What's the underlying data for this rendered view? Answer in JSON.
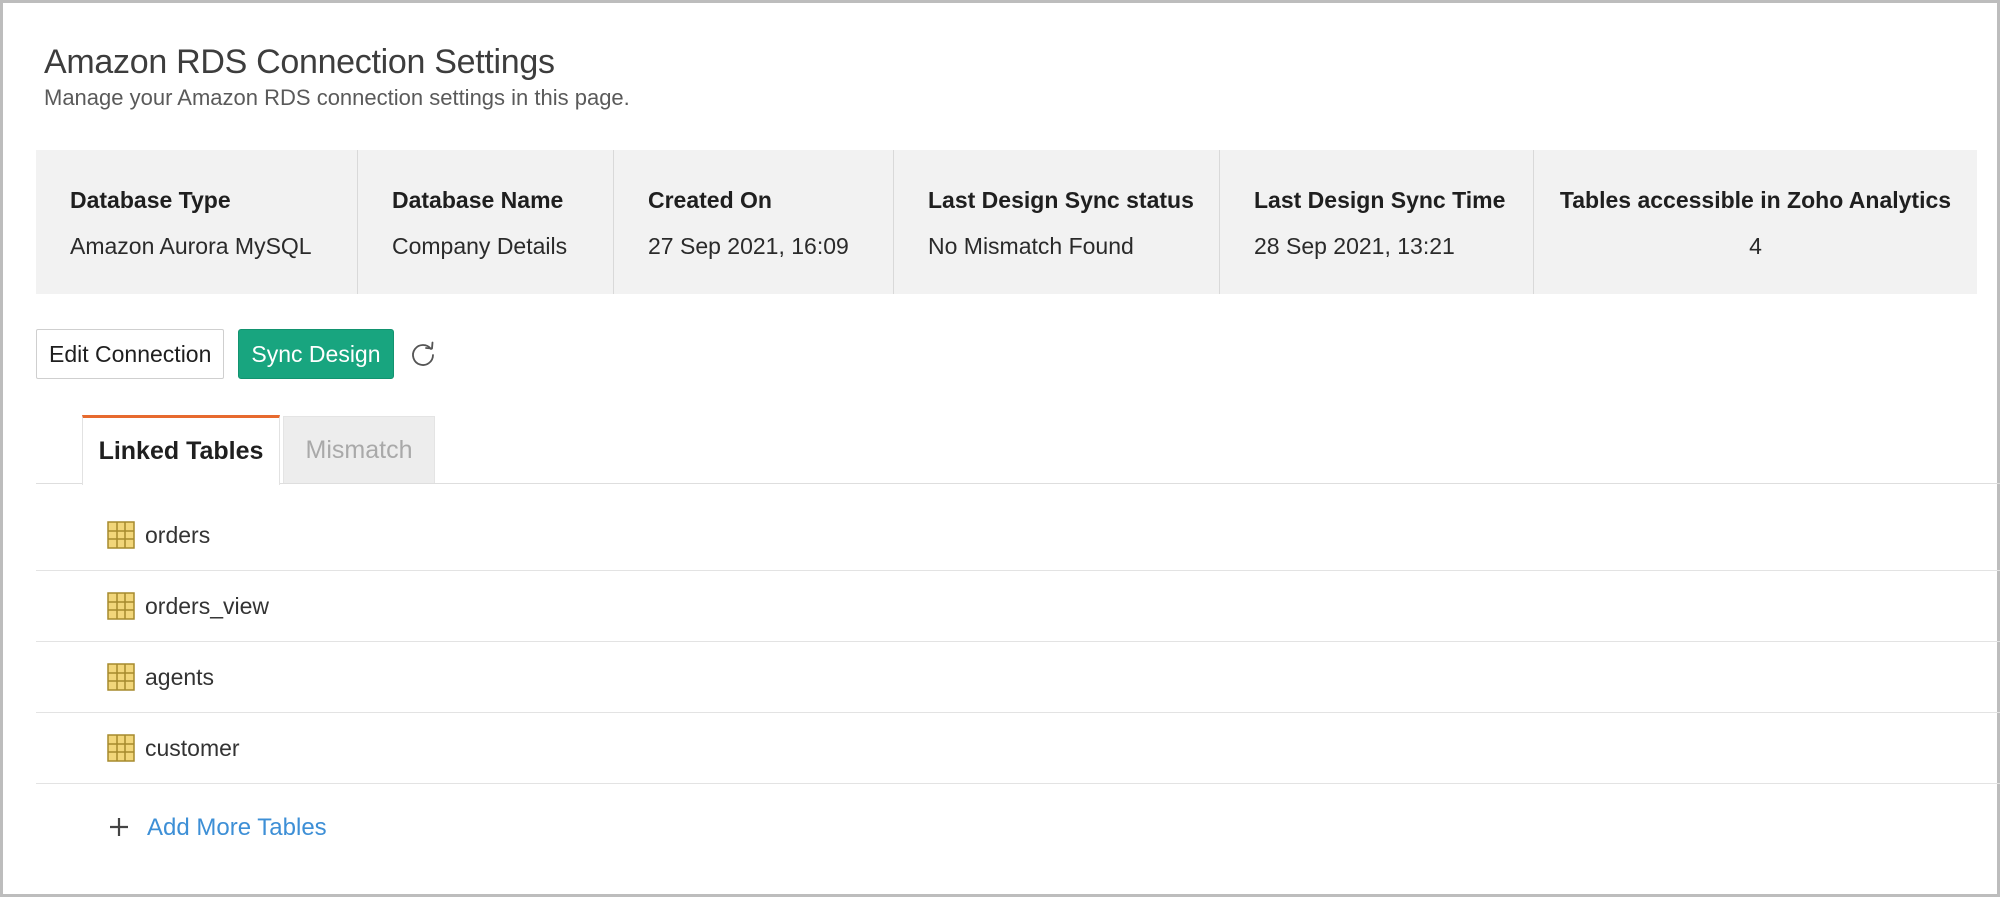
{
  "header": {
    "title": "Amazon RDS Connection Settings",
    "subtitle": "Manage your Amazon RDS connection settings in this page."
  },
  "summary": [
    {
      "label": "Database Type",
      "value": "Amazon Aurora MySQL"
    },
    {
      "label": "Database Name",
      "value": "Company Details"
    },
    {
      "label": "Created On",
      "value": "27 Sep 2021, 16:09"
    },
    {
      "label": "Last Design Sync status",
      "value": "No Mismatch Found"
    },
    {
      "label": "Last Design Sync Time",
      "value": "28 Sep 2021, 13:21"
    },
    {
      "label": "Tables accessible in Zoho Analytics",
      "value": "4"
    }
  ],
  "actions": {
    "edit_label": "Edit Connection",
    "sync_label": "Sync Design",
    "refresh_icon": "refresh-icon"
  },
  "tabs": [
    {
      "label": "Linked Tables",
      "active": true
    },
    {
      "label": "Mismatch",
      "active": false
    }
  ],
  "tables": [
    {
      "name": "orders",
      "icon": "table-grid-icon"
    },
    {
      "name": "orders_view",
      "icon": "table-grid-icon"
    },
    {
      "name": "agents",
      "icon": "table-grid-icon"
    },
    {
      "name": "customer",
      "icon": "table-grid-icon"
    }
  ],
  "add_more": {
    "label": "Add More Tables",
    "icon": "plus-icon"
  },
  "colors": {
    "accent_tab": "#e76a2e",
    "sync_button": "#18a57f",
    "link": "#3d8fd6",
    "table_icon_fill": "#f2d67a",
    "table_icon_stroke": "#a68a2d"
  }
}
